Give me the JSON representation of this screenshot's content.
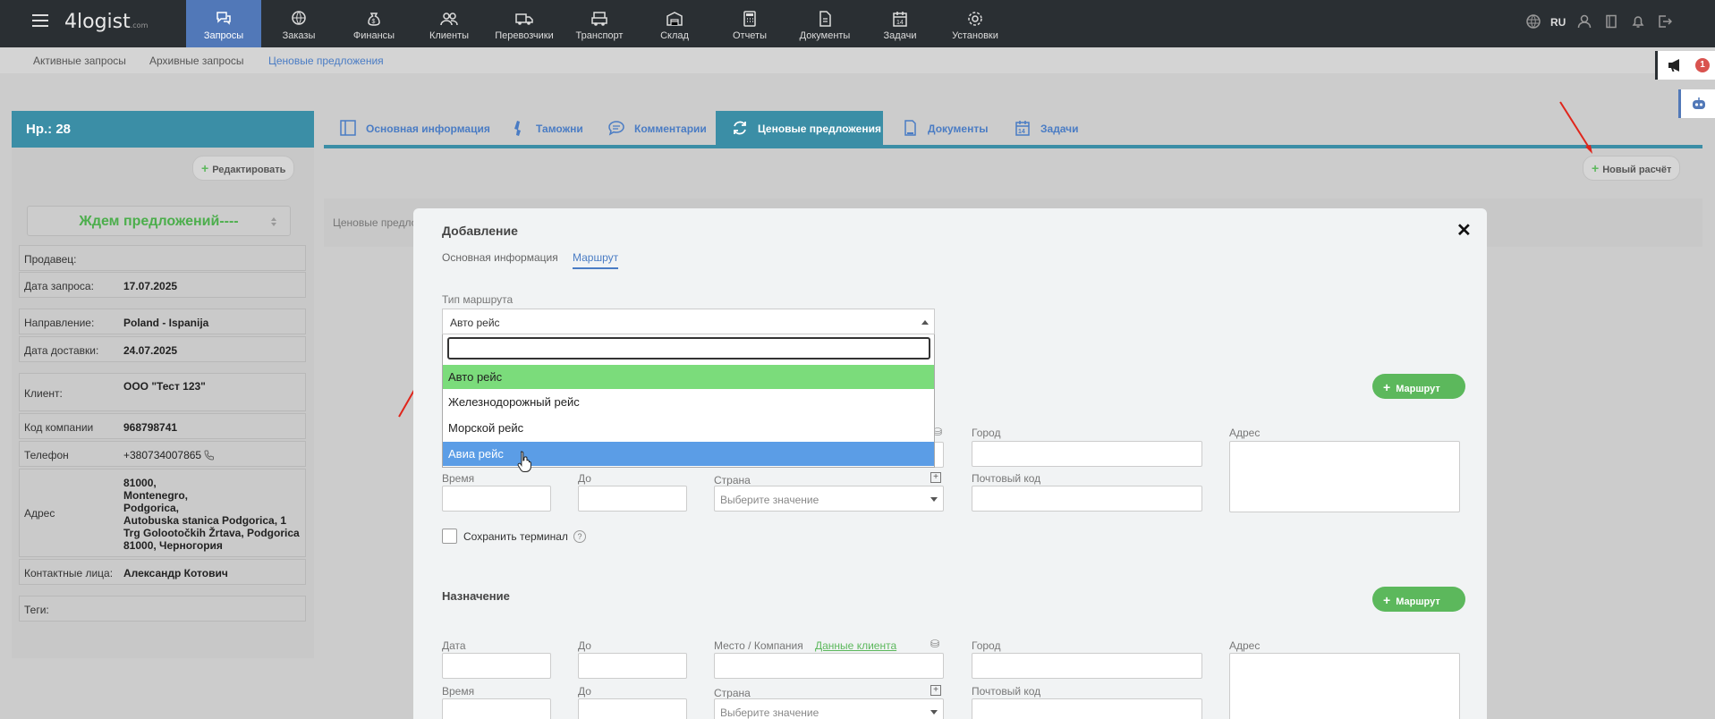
{
  "app": {
    "logo_main": "4logist",
    "logo_suffix": ".com"
  },
  "nav": [
    {
      "label": "Запросы",
      "icon": "chat-icon",
      "active": true
    },
    {
      "label": "Заказы",
      "icon": "globe-box-icon"
    },
    {
      "label": "Финансы",
      "icon": "money-bag-icon"
    },
    {
      "label": "Клиенты",
      "icon": "users-icon"
    },
    {
      "label": "Перевозчики",
      "icon": "truck-icon"
    },
    {
      "label": "Транспорт",
      "icon": "vehicle-icon"
    },
    {
      "label": "Склад",
      "icon": "warehouse-icon"
    },
    {
      "label": "Отчеты",
      "icon": "calculator-icon"
    },
    {
      "label": "Документы",
      "icon": "document-icon"
    },
    {
      "label": "Задачи",
      "icon": "calendar-icon"
    },
    {
      "label": "Установки",
      "icon": "gear-icon"
    }
  ],
  "topright": {
    "lang": "RU",
    "notification_count": "1"
  },
  "subnav": [
    "Активные запросы",
    "Архивные запросы",
    "Ценовые предложения"
  ],
  "left": {
    "header": "Нр.: 28",
    "edit_button": "Редактировать",
    "status": "Ждем предложений----",
    "fields": {
      "seller_label": "Продавец:",
      "request_date_label": "Дата запроса:",
      "request_date": "17.07.2025",
      "direction_label": "Направление:",
      "direction": "Poland - Ispanija",
      "delivery_date_label": "Дата доставки:",
      "delivery_date": "24.07.2025",
      "client_label": "Клиент:",
      "client": "ООО \"Тест 123\"",
      "company_code_label": "Код компании",
      "company_code": "968798741",
      "phone_label": "Телефон",
      "phone": "+380734007865",
      "address_label": "Адрес",
      "address": [
        "81000,",
        "Montenegro,",
        "Podgorica,",
        "Autobuska stanica Podgorica, 1",
        "Trg Golootočkih Žrtava, Podgorica",
        "81000, Черногория"
      ],
      "contacts_label": "Контактные лица:",
      "contacts": "Александр Котович",
      "tags_label": "Теги:"
    }
  },
  "tabs": [
    {
      "label": "Основная информация",
      "icon": "layout-icon"
    },
    {
      "label": "Таможни",
      "icon": "stamp-icon"
    },
    {
      "label": "Комментарии",
      "icon": "comment-icon"
    },
    {
      "label": "Ценовые предложения",
      "icon": "refresh-icon",
      "active": true
    },
    {
      "label": "Документы",
      "icon": "doc-icon"
    },
    {
      "label": "Задачи",
      "icon": "calendar-icon"
    }
  ],
  "new_calc_button": "Новый расчёт",
  "offers_text": "Ценовые предло",
  "modal": {
    "title": "Добавление",
    "tabs": [
      "Основная информация",
      "Маршрут"
    ],
    "route_type_label": "Тип маршрута",
    "route_type_value": "Авто рейс",
    "options": [
      "Авто рейс",
      "Железнодорожный рейс",
      "Морской рейс",
      "Авиа рейс"
    ],
    "route_button": "Маршрут",
    "origin": {
      "city_label": "Город",
      "address_label": "Адрес",
      "time_label": "Время",
      "to_label": "До",
      "country_label": "Страна",
      "country_placeholder": "Выберите значение",
      "postal_label": "Почтовый код",
      "save_terminal": "Сохранить терминал"
    },
    "destination": {
      "section_title": "Назначение",
      "date_label": "Дата",
      "to_label": "До",
      "place_label": "Место / Компания",
      "client_data_link": "Данные клиента",
      "city_label": "Город",
      "address_label": "Адрес",
      "time_label": "Время",
      "to_label2": "До",
      "country_label": "Страна",
      "country_placeholder": "Выберите значение",
      "postal_label": "Почтовый код"
    }
  },
  "colors": {
    "active_nav": "#5178b8",
    "teal": "#3b8ea6",
    "green": "#5cb85c",
    "blue_link": "#4a7cc4",
    "dropdown_hover": "#5b9de6",
    "dropdown_selected": "#7bdc7b"
  }
}
